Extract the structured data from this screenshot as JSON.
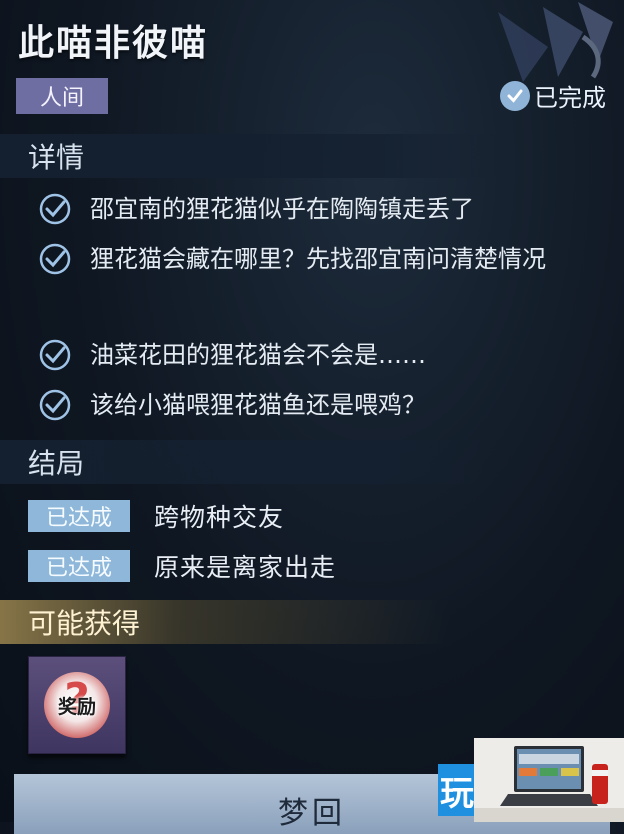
{
  "quest": {
    "title": "此喵非彼喵",
    "category": "人间",
    "status": "已完成"
  },
  "details": {
    "heading": "详情",
    "objectives": [
      {
        "text": "邵宜南的狸花猫似乎在陶陶镇走丢了",
        "completed": true
      },
      {
        "text": "狸花猫会藏在哪里？先找邵宜南问清楚情况",
        "completed": true
      },
      {
        "text": "油菜花田的狸花猫会不会是……",
        "completed": true
      },
      {
        "text": "该给小猫喂狸花猫鱼还是喂鸡？",
        "completed": true
      }
    ]
  },
  "ending": {
    "heading": "结局",
    "items": [
      {
        "badge": "已达成",
        "text": "跨物种交友"
      },
      {
        "badge": "已达成",
        "text": "原来是离家出走"
      }
    ]
  },
  "rewards": {
    "heading": "可能获得",
    "item_label": "奖励"
  },
  "action": {
    "label": "梦回"
  },
  "watermark": {
    "logo_char": "玩"
  },
  "colors": {
    "category_tag": "#6f6ea2",
    "badge": "#8fb7d9",
    "check": "#9fc3e6",
    "panel_bg": "#0f1722"
  },
  "icons": {
    "status": "check-circle-icon",
    "objective": "check-circle-icon",
    "emblem": "decorative-emblem-icon"
  }
}
